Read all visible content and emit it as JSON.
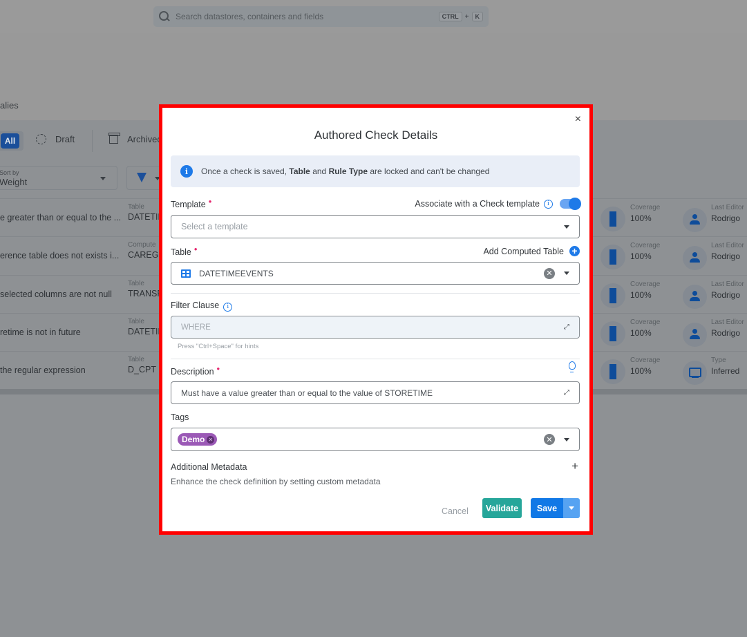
{
  "topbar": {
    "search_placeholder": "Search datastores, containers and fields",
    "shortcut_key1": "CTRL",
    "shortcut_plus": "+",
    "shortcut_key2": "K"
  },
  "page": {
    "title_partial": "alies",
    "tabs": [
      {
        "label": "All",
        "active": true
      },
      {
        "label": "Draft",
        "icon": "draft-icon"
      },
      {
        "label": "Archived",
        "icon": "archive-icon"
      }
    ],
    "sort": {
      "label": "Sort by",
      "value": "Weight"
    },
    "rows": [
      {
        "description": "e greater than or equal to the ...",
        "table_label": "Table",
        "table_value": "DATETIM",
        "coverage_label": "Coverage",
        "coverage_value": "100%",
        "editor_label": "Last Editor",
        "editor_value": "Rodrigo",
        "editor_icon": "person-icon"
      },
      {
        "description": "erence table does not exists i...",
        "table_label": "Compute",
        "table_value": "CAREGIV",
        "coverage_label": "Coverage",
        "coverage_value": "100%",
        "editor_label": "Last Editor",
        "editor_value": "Rodrigo",
        "editor_icon": "person-icon"
      },
      {
        "description": "selected columns are not null",
        "table_label": "Table",
        "table_value": "TRANSF",
        "coverage_label": "Coverage",
        "coverage_value": "100%",
        "editor_label": "Last Editor",
        "editor_value": "Rodrigo",
        "editor_icon": "person-icon"
      },
      {
        "description": "retime is not in future",
        "table_label": "Table",
        "table_value": "DATETIM",
        "coverage_label": "Coverage",
        "coverage_value": "100%",
        "editor_label": "Last Editor",
        "editor_value": "Rodrigo",
        "editor_icon": "person-icon"
      },
      {
        "description": "the regular expression",
        "table_label": "Table",
        "table_value": "D_CPT",
        "coverage_label": "Coverage",
        "coverage_value": "100%",
        "editor_label": "Type",
        "editor_value": "Inferred",
        "editor_icon": "monitor-icon"
      }
    ]
  },
  "modal": {
    "title": "Authored Check Details",
    "close_label": "×",
    "alert": {
      "prefix": "Once a check is saved, ",
      "bold1": "Table",
      "mid": " and ",
      "bold2": "Rule Type",
      "suffix": " are locked and can't be changed"
    },
    "template": {
      "label": "Template",
      "required": "•",
      "associate_label": "Associate with a Check template",
      "associate_enabled": true,
      "placeholder": "Select a template"
    },
    "table": {
      "label": "Table",
      "required": "•",
      "add_computed_label": "Add Computed Table",
      "value": "DATETIMEEVENTS"
    },
    "filter": {
      "label": "Filter Clause",
      "placeholder": "WHERE",
      "hint": "Press \"Ctrl+Space\" for hints"
    },
    "description": {
      "label": "Description",
      "required": "•",
      "value": "Must have a value greater than or equal to the value of STORETIME"
    },
    "tags": {
      "label": "Tags",
      "items": [
        {
          "label": "Demo",
          "color": "#9b59b6"
        }
      ]
    },
    "metadata": {
      "title": "Additional Metadata",
      "description": "Enhance the check definition by setting custom metadata",
      "add_label": "+"
    },
    "buttons": {
      "cancel": "Cancel",
      "validate": "Validate",
      "save": "Save"
    }
  },
  "colors": {
    "primary": "#1e7ae8",
    "validate": "#26a69a",
    "tag": "#9b59b6",
    "required": "#e6266e",
    "highlight_frame": "#ff0000"
  }
}
